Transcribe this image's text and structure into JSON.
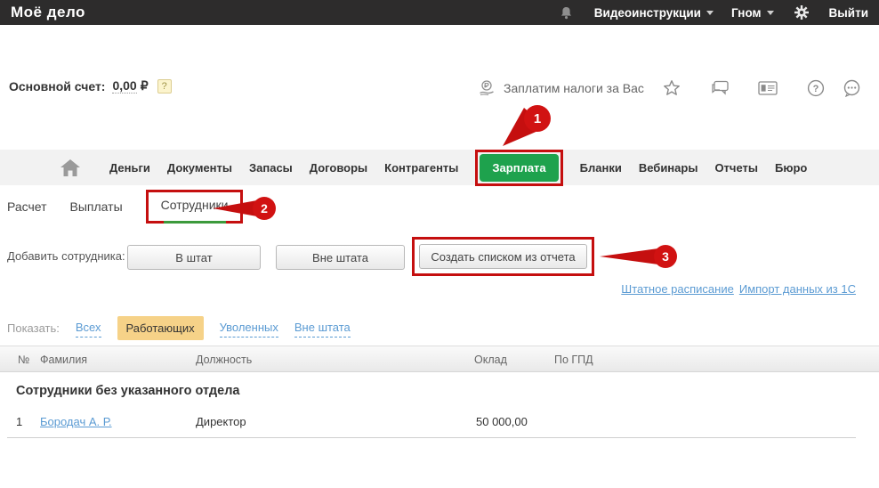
{
  "topbar": {
    "logo": "Моё дело",
    "video_label": "Видеоинструкции",
    "user_label": "Гном",
    "logout_label": "Выйти"
  },
  "account": {
    "label": "Основной счет:",
    "balance": "0,00",
    "currency": "₽",
    "help_badge": "?"
  },
  "promo": {
    "text": "Заплатим налоги за Вас"
  },
  "nav": {
    "items": [
      {
        "label": "Деньги",
        "active": false
      },
      {
        "label": "Документы",
        "active": false
      },
      {
        "label": "Запасы",
        "active": false
      },
      {
        "label": "Договоры",
        "active": false
      },
      {
        "label": "Контрагенты",
        "active": false
      },
      {
        "label": "Зарплата",
        "active": true
      },
      {
        "label": "Бланки",
        "active": false
      },
      {
        "label": "Вебинары",
        "active": false
      },
      {
        "label": "Отчеты",
        "active": false
      },
      {
        "label": "Бюро",
        "active": false
      }
    ]
  },
  "subnav": {
    "items": [
      {
        "label": "Расчет",
        "active": false
      },
      {
        "label": "Выплаты",
        "active": false
      },
      {
        "label": "Сотрудники",
        "active": true
      }
    ]
  },
  "add_employee": {
    "label": "Добавить сотрудника:",
    "buttons": [
      {
        "label": "В штат"
      },
      {
        "label": "Вне штата"
      },
      {
        "label": "Создать списком из отчета"
      }
    ]
  },
  "links": {
    "staff_schedule": "Штатное расписание",
    "import_1c": "Импорт данных из 1С"
  },
  "filter": {
    "label": "Показать:",
    "options": [
      {
        "label": "Всех",
        "active": false
      },
      {
        "label": "Работающих",
        "active": true
      },
      {
        "label": "Уволенных",
        "active": false
      },
      {
        "label": "Вне штата",
        "active": false
      }
    ]
  },
  "table": {
    "headers": [
      "№",
      "Фамилия",
      "Должность",
      "Оклад",
      "По ГПД"
    ],
    "group_header": "Сотрудники без указанного отдела",
    "rows": [
      {
        "num": "1",
        "name": "Бородач А. Р.",
        "position": "Директор",
        "salary": "50 000,00",
        "gpd": ""
      }
    ]
  },
  "annotations": {
    "step1": "1",
    "step2": "2",
    "step3": "3"
  },
  "colors": {
    "topbar_bg": "#2d2c2c",
    "nav_bg": "#f2f2f2",
    "active_nav_green": "#1ea24d",
    "annotation_red": "#c50f0f",
    "filter_highlight": "#f6d288",
    "link_blue": "#5b9bd3",
    "underline_green": "#3c9a3c"
  },
  "icons": {
    "bell": "bell-icon",
    "gear": "gear-icon",
    "home": "home-icon",
    "ruble_hand": "ruble-hand-icon",
    "star": "star-icon",
    "chat": "chat-icon",
    "id_card": "id-card-icon",
    "help": "help-circle-icon",
    "more": "more-bubble-icon"
  }
}
